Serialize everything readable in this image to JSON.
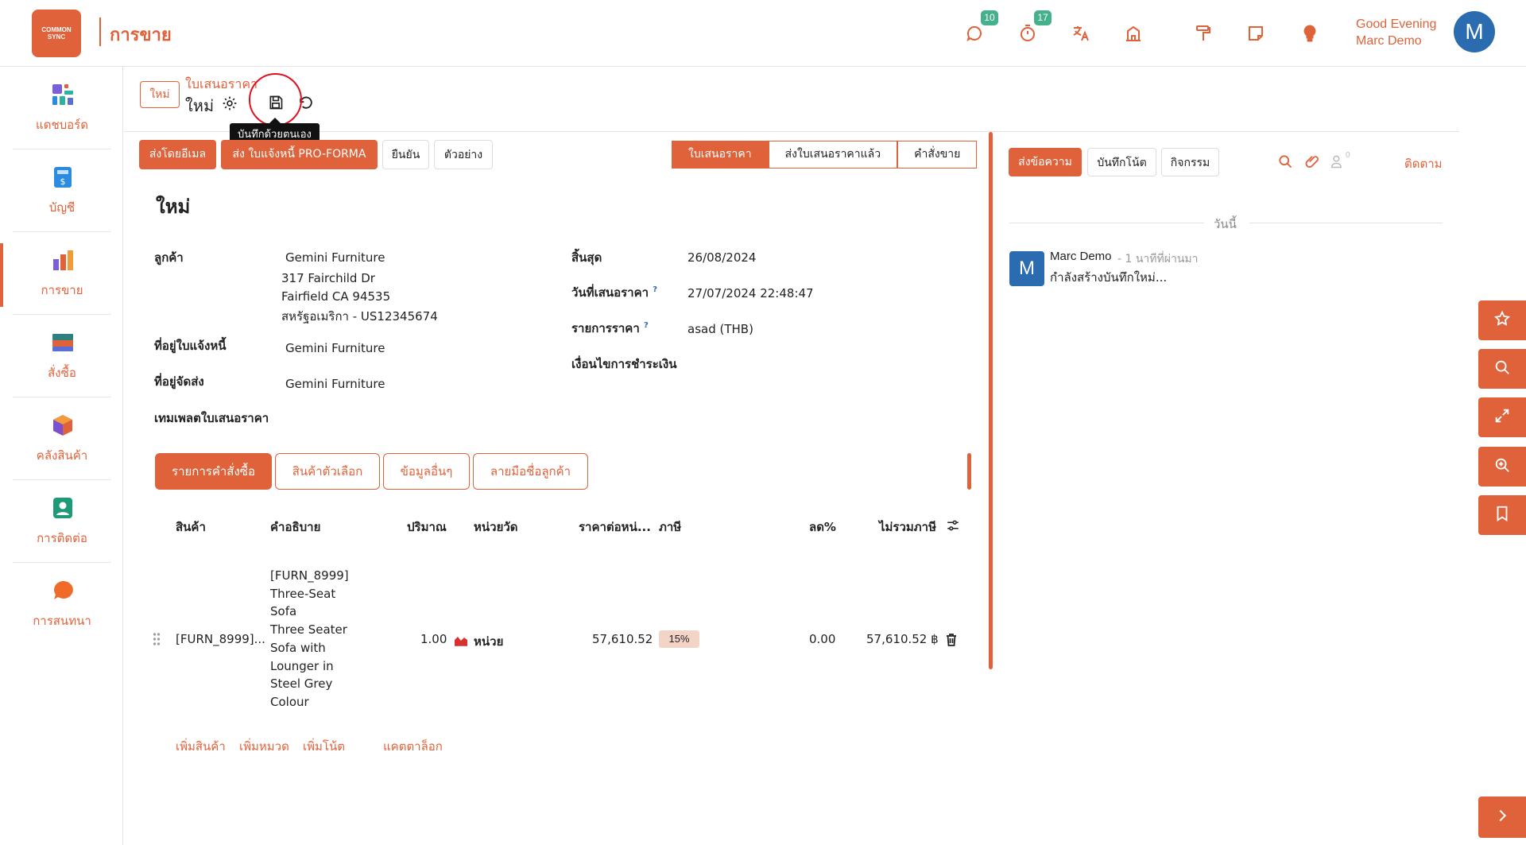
{
  "app": {
    "logo_text": "COMMON SYNC",
    "title": "การขาย"
  },
  "topbar": {
    "messages_count": "10",
    "activities_count": "17",
    "greeting_line1": "Good Evening",
    "greeting_line2": "Marc Demo",
    "avatar_letter": "M",
    "icons": [
      "chat-icon",
      "timer-icon",
      "translate-icon",
      "company-icon",
      "paint-roller-icon",
      "note-icon",
      "lightbulb-icon"
    ]
  },
  "sidebar": {
    "items": [
      {
        "label": "แดชบอร์ด",
        "icon": "dashboard-icon",
        "color": "#5a6fd6"
      },
      {
        "label": "บัญชี",
        "icon": "accounting-icon",
        "color": "#2b8be0"
      },
      {
        "label": "การขาย",
        "icon": "sales-icon",
        "color": "#e0623a"
      },
      {
        "label": "สั่งซื้อ",
        "icon": "purchase-icon",
        "color": "#2f7f7f"
      },
      {
        "label": "คลังสินค้า",
        "icon": "inventory-icon",
        "color": "#7a4fd0"
      },
      {
        "label": "การติดต่อ",
        "icon": "contacts-icon",
        "color": "#1f9a76"
      },
      {
        "label": "การสนทนา",
        "icon": "discuss-icon",
        "color": "#f06a2a"
      }
    ]
  },
  "control": {
    "new_button": "ใหม่",
    "breadcrumb_parent": "ใบเสนอราคา",
    "breadcrumb_current": "ใหม่",
    "tooltip": "บันทึกด้วยตนเอง"
  },
  "actions": {
    "send_email": "ส่งโดยอีเมล",
    "send_proforma": "ส่ง ใบแจ้งหนี้ PRO-FORMA",
    "confirm": "ยืนยัน",
    "preview": "ตัวอย่าง"
  },
  "status": {
    "steps": [
      "ใบเสนอราคา",
      "ส่งใบเสนอราคาแล้ว",
      "คำสั่งขาย"
    ],
    "active": "ใบเสนอราคา"
  },
  "form": {
    "title": "ใหม่",
    "customer_label": "ลูกค้า",
    "customer_name": "Gemini Furniture",
    "customer_addr1": "317 Fairchild Dr",
    "customer_addr2": "Fairfield CA 94535",
    "customer_addr3": "สหรัฐอเมริกา - US12345674",
    "invoice_addr_label": "ที่อยู่ใบแจ้งหนี้",
    "invoice_addr_value": "Gemini Furniture",
    "delivery_addr_label": "ที่อยู่จัดส่ง",
    "delivery_addr_value": "Gemini Furniture",
    "template_label": "เทมเพลตใบเสนอราคา",
    "expiry_label": "สิ้นสุด",
    "expiry_value": "26/08/2024",
    "quote_date_label": "วันที่เสนอราคา",
    "quote_date_value": "27/07/2024 22:48:47",
    "pricelist_label": "รายการราคา",
    "pricelist_value": "asad (THB)",
    "payment_terms_label": "เงื่อนไขการชำระเงิน",
    "help_mark": "?"
  },
  "notebook": {
    "tabs": [
      "รายการคำสั่งซื้อ",
      "สินค้าตัวเลือก",
      "ข้อมูลอื่นๆ",
      "ลายมือชื่อลูกค้า"
    ]
  },
  "lines": {
    "headers": {
      "product": "สินค้า",
      "description": "คำอธิบาย",
      "quantity": "ปริมาณ",
      "uom": "หน่วยวัด",
      "unit_price": "ราคาต่อหน่...",
      "taxes": "ภาษี",
      "discount": "ลด%",
      "subtotal": "ไม่รวมภาษี"
    },
    "rows": [
      {
        "product": "[FURN_8999]...",
        "description_lines": [
          "[FURN_8999]",
          "Three-Seat",
          "Sofa",
          "Three Seater",
          "Sofa with",
          "Lounger in",
          "Steel Grey",
          "Colour"
        ],
        "quantity": "1.00",
        "uom": "หน่วย",
        "unit_price": "57,610.52",
        "tax": "15%",
        "discount": "0.00",
        "subtotal": "57,610.52 ฿"
      }
    ],
    "add_product": "เพิ่มสินค้า",
    "add_section": "เพิ่มหมวด",
    "add_note": "เพิ่มโน้ต",
    "catalog": "แคตตาล็อก"
  },
  "chatter": {
    "send_message": "ส่งข้อความ",
    "log_note": "บันทึกโน้ต",
    "activities": "กิจกรรม",
    "followers_count": "0",
    "follow": "ติดตาม",
    "today": "วันนี้",
    "message": {
      "avatar_letter": "M",
      "author": "Marc Demo",
      "time": "- 1 นาทีที่ผ่านมา",
      "body": "กำลังสร้างบันทึกใหม่..."
    }
  },
  "colors": {
    "accent": "#e0623a",
    "badge": "#45b08c",
    "avatar": "#2b6cb0",
    "annotation": "#e0101f"
  }
}
